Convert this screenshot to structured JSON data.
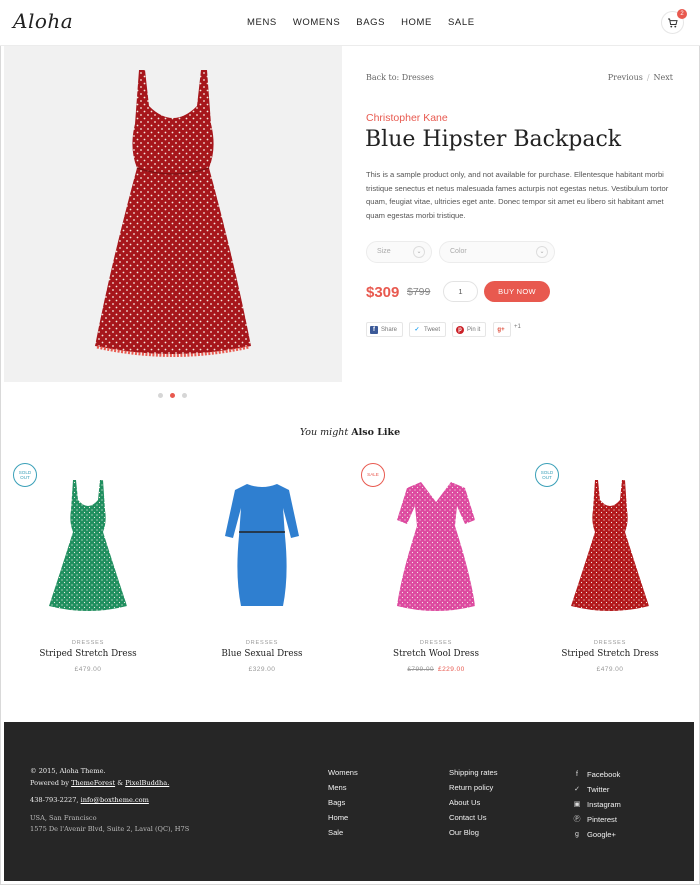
{
  "header": {
    "logo": "Aloha",
    "nav": [
      "MENS",
      "WOMENS",
      "BAGS",
      "HOME",
      "SALE"
    ],
    "cart_count": "2"
  },
  "product": {
    "back_link": "Back to: Dresses",
    "previous": "Previous",
    "separator": "/",
    "next": "Next",
    "brand": "Christopher Kane",
    "title": "Blue Hipster Backpack",
    "description": "This is a sample product only, and not available for purchase. Ellentesque habitant morbi tristique senectus et netus malesuada fames acturpis not egestas netus. Vestibulum tortor quam, feugiat vitae, ultricies eget ante. Donec tempor sit amet eu libero sit habitant amet quam egestas morbi tristique.",
    "size_placeholder": "Size",
    "color_placeholder": "Color",
    "price": "$309",
    "old_price": "$799",
    "quantity": "1",
    "buy_label": "BUY NOW",
    "share": {
      "facebook": "Share",
      "twitter": "Tweet",
      "pinterest": "Pin it",
      "gplus_count": "+1"
    },
    "gallery_active_index": 1
  },
  "related": {
    "heading_italic": "You might",
    "heading_bold": "Also Like",
    "items": [
      {
        "badge": "SOLD OUT",
        "badge_type": "sold",
        "category": "DRESSES",
        "name": "Striped Stretch Dress",
        "price": "£479.00",
        "old_price": "",
        "dress_color": "#1f8f5f"
      },
      {
        "badge": "",
        "badge_type": "",
        "category": "DRESSES",
        "name": "Blue Sexual Dress",
        "price": "£329.00",
        "old_price": "",
        "dress_color": "#2f7fd0"
      },
      {
        "badge": "SALE",
        "badge_type": "sale",
        "category": "DRESSES",
        "name": "Stretch Wool Dress",
        "price": "£229.00",
        "old_price": "£799.00",
        "dress_color": "#dd4aa0"
      },
      {
        "badge": "SOLD OUT",
        "badge_type": "sold",
        "category": "DRESSES",
        "name": "Striped Stretch Dress",
        "price": "£479.00",
        "old_price": "",
        "dress_color": "#b3191c"
      }
    ]
  },
  "footer": {
    "copyright": "© 2015, Aloha Theme.",
    "powered_prefix": "Powered by",
    "themeforest": "ThemeForest",
    "amp": "&",
    "pixelbuddha": "PixelBuddha.",
    "phone": "438-793-2227,",
    "email": "info@boxtheme.com",
    "city": "USA, San Francisco",
    "address": "1575 De l'Avenir Blvd, Suite 2, Laval (QC), H7S",
    "col1": [
      "Womens",
      "Mens",
      "Bags",
      "Home",
      "Sale"
    ],
    "col2": [
      "Shipping rates",
      "Return policy",
      "About Us",
      "Contact Us",
      "Our Blog"
    ],
    "social": [
      "Facebook",
      "Twitter",
      "Instagram",
      "Pinterest",
      "Google+"
    ]
  },
  "colors": {
    "accent": "#e8594f",
    "footer_bg": "#262626",
    "main_dress": "#b3191c"
  }
}
